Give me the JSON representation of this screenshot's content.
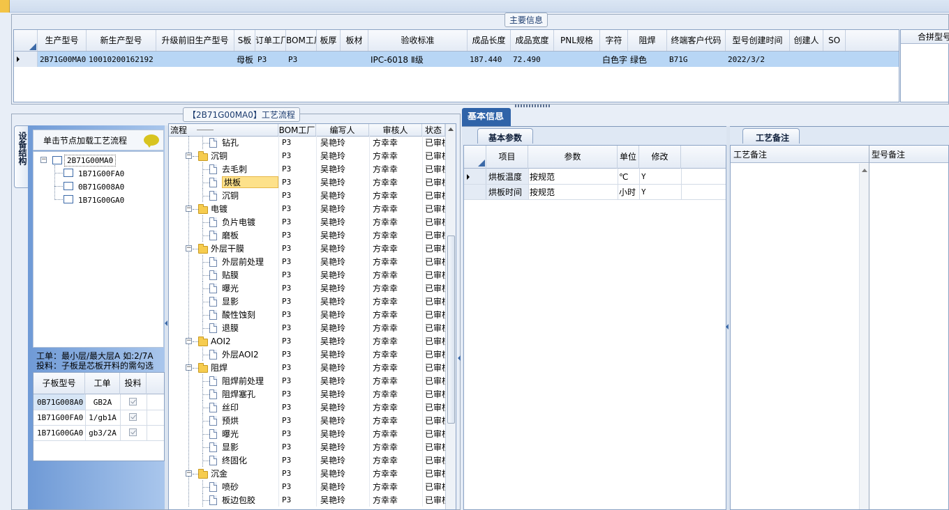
{
  "main_info": {
    "title": "主要信息",
    "columns": [
      "生产型号",
      "新生产型号",
      "升级前旧生产型号",
      "S板",
      "订单工厂",
      "BOM工厂",
      "板厚",
      "板材",
      "验收标准",
      "成品长度",
      "成品宽度",
      "PNL规格",
      "字符",
      "阻焊",
      "终端客户代码",
      "型号创建时间",
      "创建人",
      "SO"
    ],
    "row": [
      "2B71G00MA0",
      "10010200162192",
      "",
      "母板",
      "P3",
      "P3",
      "",
      "",
      "IPC-6018 Ⅱ级",
      "187.440",
      "72.490",
      "",
      "白色字符",
      "绿色",
      "B71G",
      "2022/3/2",
      "",
      ""
    ],
    "side_header": "合拼型号"
  },
  "process_flow": {
    "title": "【2B71G00MA0】工艺流程",
    "columns": [
      "流程",
      "BOM工厂",
      "编写人",
      "审核人",
      "状态"
    ],
    "rows": [
      {
        "name": "钻孔",
        "level": 2,
        "bom": "P3",
        "writer": "吴艳玲",
        "reviewer": "方幸幸",
        "status": "已审核"
      },
      {
        "name": "沉铜",
        "level": 1,
        "bom": "P3",
        "writer": "吴艳玲",
        "reviewer": "方幸幸",
        "status": "已审核"
      },
      {
        "name": "去毛刺",
        "level": 2,
        "bom": "P3",
        "writer": "吴艳玲",
        "reviewer": "方幸幸",
        "status": "已审核"
      },
      {
        "name": "烘板",
        "level": 2,
        "bom": "P3",
        "writer": "吴艳玲",
        "reviewer": "方幸幸",
        "status": "已审核",
        "selected": true
      },
      {
        "name": "沉铜",
        "level": 2,
        "bom": "P3",
        "writer": "吴艳玲",
        "reviewer": "方幸幸",
        "status": "已审核"
      },
      {
        "name": "电镀",
        "level": 1,
        "bom": "P3",
        "writer": "吴艳玲",
        "reviewer": "方幸幸",
        "status": "已审核"
      },
      {
        "name": "负片电镀",
        "level": 2,
        "bom": "P3",
        "writer": "吴艳玲",
        "reviewer": "方幸幸",
        "status": "已审核"
      },
      {
        "name": "磨板",
        "level": 2,
        "bom": "P3",
        "writer": "吴艳玲",
        "reviewer": "方幸幸",
        "status": "已审核"
      },
      {
        "name": "外层干膜",
        "level": 1,
        "bom": "P3",
        "writer": "吴艳玲",
        "reviewer": "方幸幸",
        "status": "已审核"
      },
      {
        "name": "外层前处理",
        "level": 2,
        "bom": "P3",
        "writer": "吴艳玲",
        "reviewer": "方幸幸",
        "status": "已审核"
      },
      {
        "name": "贴膜",
        "level": 2,
        "bom": "P3",
        "writer": "吴艳玲",
        "reviewer": "方幸幸",
        "status": "已审核"
      },
      {
        "name": "曝光",
        "level": 2,
        "bom": "P3",
        "writer": "吴艳玲",
        "reviewer": "方幸幸",
        "status": "已审核"
      },
      {
        "name": "显影",
        "level": 2,
        "bom": "P3",
        "writer": "吴艳玲",
        "reviewer": "方幸幸",
        "status": "已审核"
      },
      {
        "name": "酸性蚀刻",
        "level": 2,
        "bom": "P3",
        "writer": "吴艳玲",
        "reviewer": "方幸幸",
        "status": "已审核"
      },
      {
        "name": "退膜",
        "level": 2,
        "bom": "P3",
        "writer": "吴艳玲",
        "reviewer": "方幸幸",
        "status": "已审核"
      },
      {
        "name": "AOI2",
        "level": 1,
        "bom": "P3",
        "writer": "吴艳玲",
        "reviewer": "方幸幸",
        "status": "已审核"
      },
      {
        "name": "外层AOI2",
        "level": 2,
        "bom": "P3",
        "writer": "吴艳玲",
        "reviewer": "方幸幸",
        "status": "已审核"
      },
      {
        "name": "阻焊",
        "level": 1,
        "bom": "P3",
        "writer": "吴艳玲",
        "reviewer": "方幸幸",
        "status": "已审核"
      },
      {
        "name": "阻焊前处理",
        "level": 2,
        "bom": "P3",
        "writer": "吴艳玲",
        "reviewer": "方幸幸",
        "status": "已审核"
      },
      {
        "name": "阻焊塞孔",
        "level": 2,
        "bom": "P3",
        "writer": "吴艳玲",
        "reviewer": "方幸幸",
        "status": "已审核"
      },
      {
        "name": "丝印",
        "level": 2,
        "bom": "P3",
        "writer": "吴艳玲",
        "reviewer": "方幸幸",
        "status": "已审核"
      },
      {
        "name": "预烘",
        "level": 2,
        "bom": "P3",
        "writer": "吴艳玲",
        "reviewer": "方幸幸",
        "status": "已审核"
      },
      {
        "name": "曝光",
        "level": 2,
        "bom": "P3",
        "writer": "吴艳玲",
        "reviewer": "方幸幸",
        "status": "已审核"
      },
      {
        "name": "显影",
        "level": 2,
        "bom": "P3",
        "writer": "吴艳玲",
        "reviewer": "方幸幸",
        "status": "已审核"
      },
      {
        "name": "终固化",
        "level": 2,
        "bom": "P3",
        "writer": "吴艳玲",
        "reviewer": "方幸幸",
        "status": "已审核"
      },
      {
        "name": "沉金",
        "level": 1,
        "bom": "P3",
        "writer": "吴艳玲",
        "reviewer": "方幸幸",
        "status": "已审核"
      },
      {
        "name": "喷砂",
        "level": 2,
        "bom": "P3",
        "writer": "吴艳玲",
        "reviewer": "方幸幸",
        "status": "已审核"
      },
      {
        "name": "板边包胶",
        "level": 2,
        "bom": "P3",
        "writer": "吴艳玲",
        "reviewer": "方幸幸",
        "status": "已审核"
      }
    ]
  },
  "structure": {
    "side_tab": "设备结构",
    "hint": "单击节点加载工艺流程",
    "root": "2B71G00MA0",
    "children": [
      "1B71G00FA0",
      "0B71G008A0",
      "1B71G00GA0"
    ],
    "note_line1": "工单：最小层/最大层A 如:2/7A",
    "note_line2": "投料：子板是芯板开料的需勾选",
    "sub_columns": [
      "子板型号",
      "工单",
      "投料"
    ],
    "sub_rows": [
      {
        "model": "0B71G008A0",
        "order": "GB2A"
      },
      {
        "model": "1B71G00FA0",
        "order": "1/gb1A"
      },
      {
        "model": "1B71G00GA0",
        "order": "gb3/2A"
      }
    ]
  },
  "basic_info": {
    "tab": "基本信息",
    "subtab": "基本参数",
    "columns": [
      "项目",
      "参数",
      "单位",
      "修改"
    ],
    "rows": [
      {
        "item": "烘板温度",
        "param": "按规范",
        "unit": "℃",
        "modify": "Y"
      },
      {
        "item": "烘板时间",
        "param": "按规范",
        "unit": "小时",
        "modify": "Y"
      }
    ]
  },
  "remarks": {
    "tab": "工艺备注",
    "col1": "工艺备注",
    "col2": "型号备注"
  },
  "colors": {
    "selection": "#b8d6f5",
    "tree_selection": "#fde18a",
    "tab_blue": "#2f63a8",
    "header_bg": "#e4ebf5"
  }
}
